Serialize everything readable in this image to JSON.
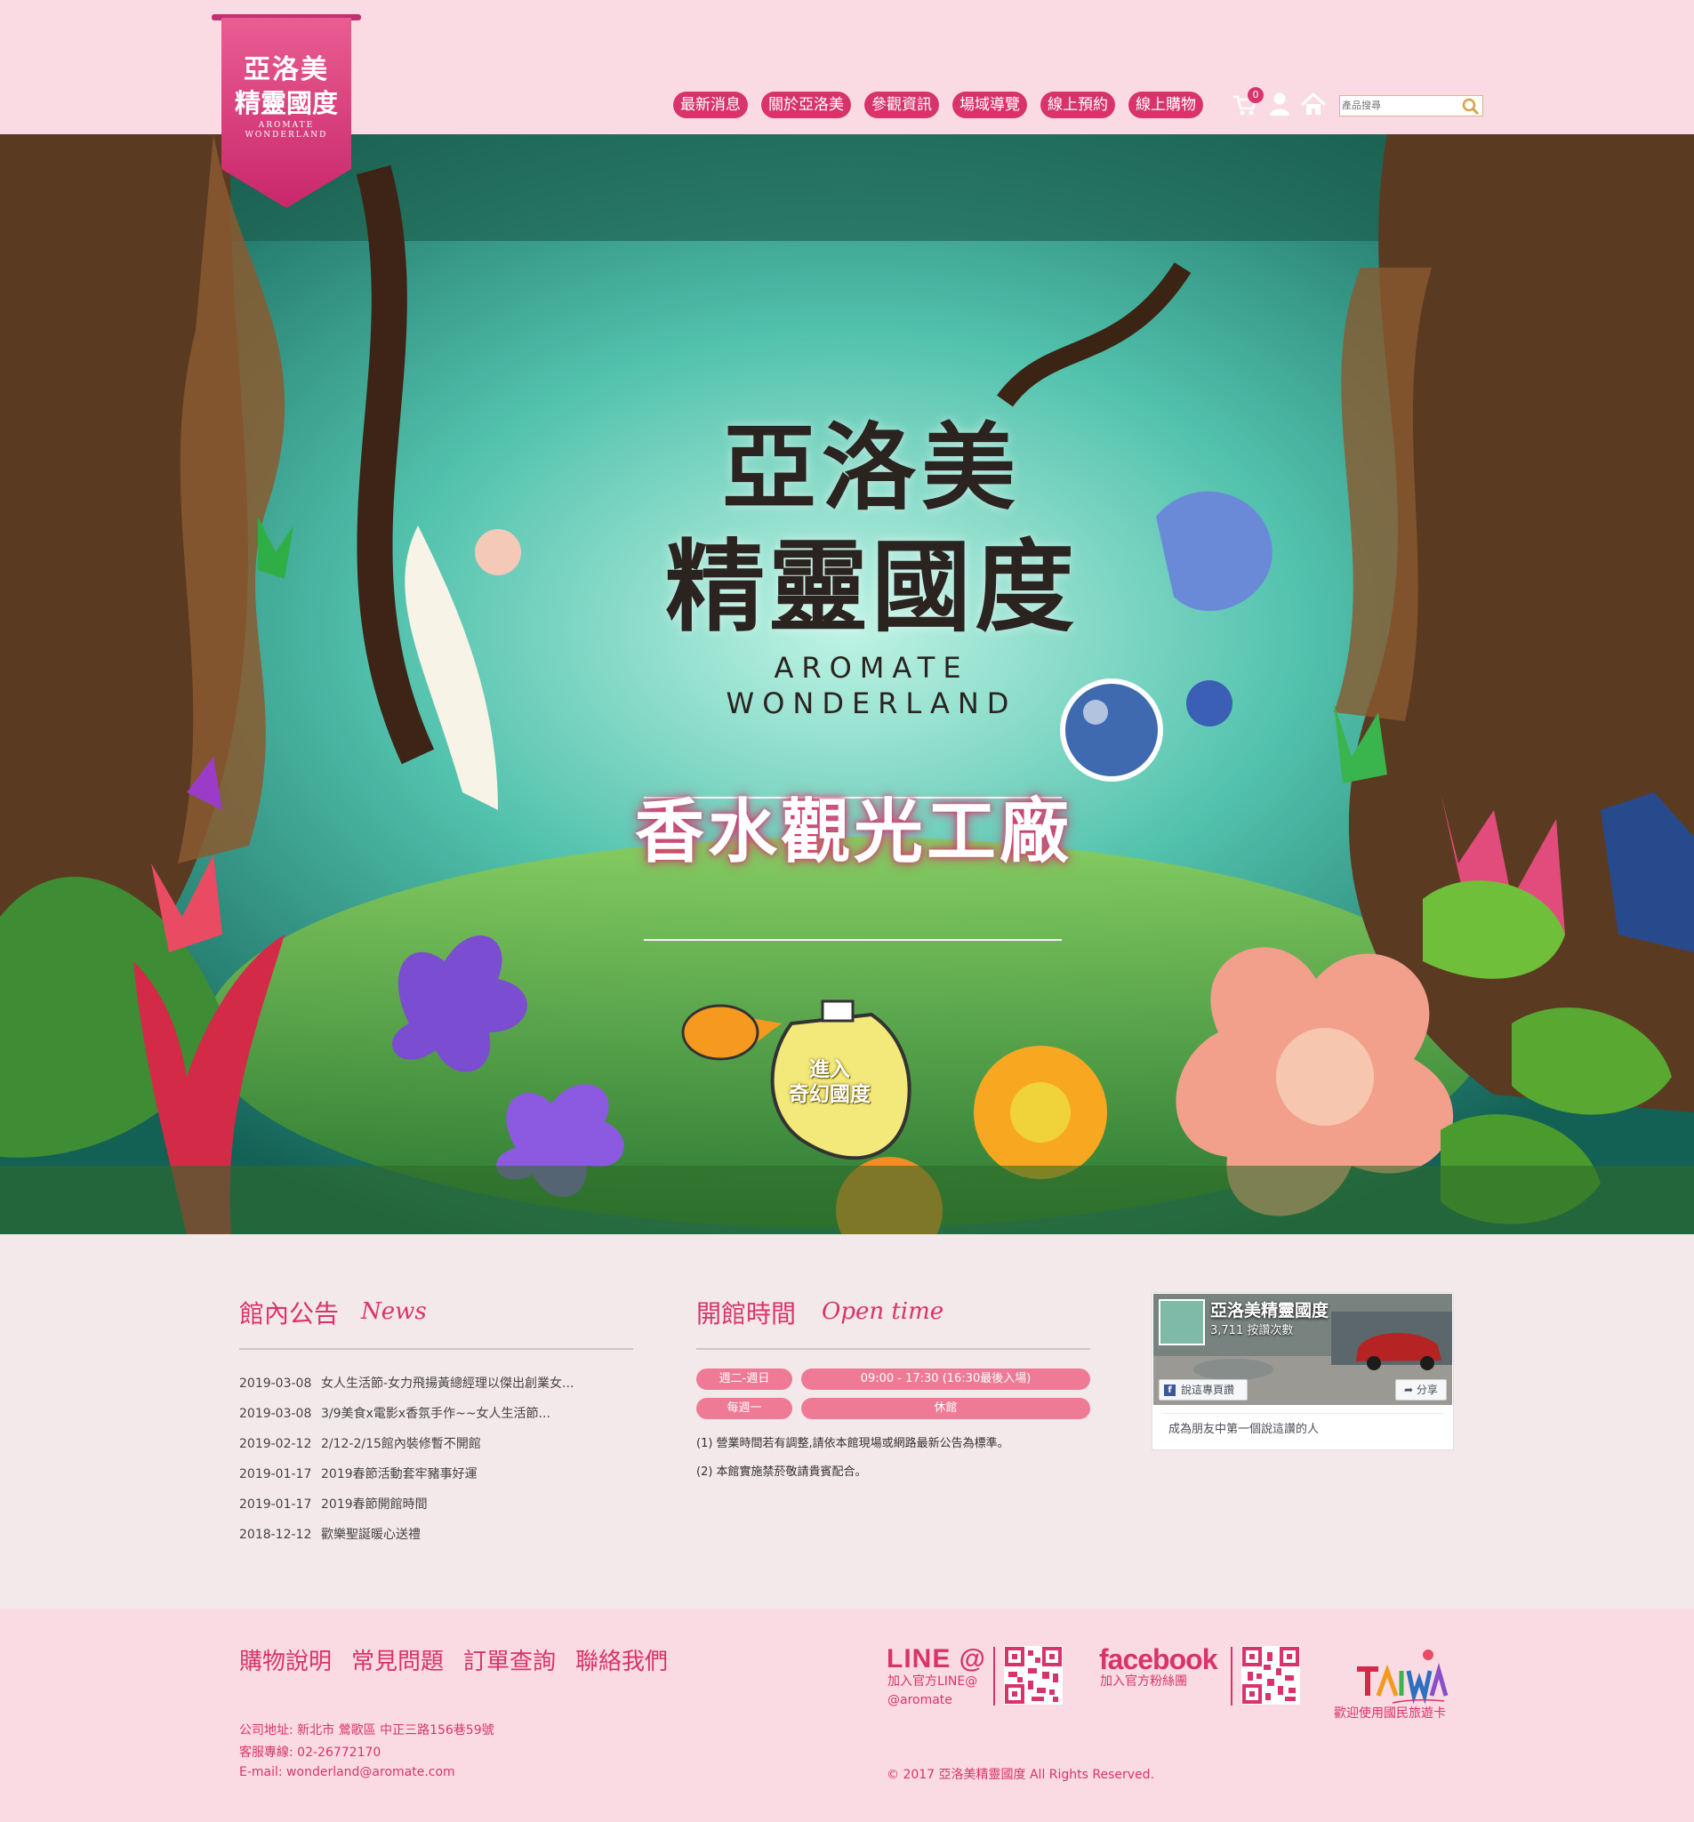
{
  "brand": {
    "logo_line1": "亞洛美",
    "logo_line2": "精靈國度",
    "logo_en": "AROMATE WONDERLAND"
  },
  "nav": {
    "items": [
      "最新消息",
      "關於亞洛美",
      "參觀資訊",
      "場域導覽",
      "線上預約",
      "線上購物"
    ],
    "cart_count": "0",
    "search_placeholder": "產品搜尋"
  },
  "hero": {
    "title_line1": "亞洛美",
    "title_line2": "精靈國度",
    "title_en1": "AROMATE",
    "title_en2": "WONDERLAND",
    "subtitle": "香水觀光工廠",
    "enter_line1": "進入",
    "enter_line2": "奇幻國度"
  },
  "news": {
    "title": "館內公告",
    "title_en": "News",
    "items": [
      {
        "date": "2019-03-08",
        "text": "女人生活節-女力飛揚黃總經理以傑出創業女..."
      },
      {
        "date": "2019-03-08",
        "text": "3/9美食x電影x香氛手作~~女人生活節..."
      },
      {
        "date": "2019-02-12",
        "text": "2/12-2/15館內裝修暫不開館"
      },
      {
        "date": "2019-01-17",
        "text": "2019春節活動套牢豬事好運"
      },
      {
        "date": "2019-01-17",
        "text": "2019春節開館時間"
      },
      {
        "date": "2018-12-12",
        "text": "歡樂聖誕暖心送禮"
      }
    ]
  },
  "open_time": {
    "title": "開館時間",
    "title_en": "Open time",
    "rows": [
      {
        "day": "週二-週日",
        "hours": "09:00 - 17:30 (16:30最後入場)"
      },
      {
        "day": "每週一",
        "hours": "休館"
      }
    ],
    "notes": [
      "(1) 營業時間若有調整,請依本館現場或網路最新公告為標準。",
      "(2) 本館實施禁菸敬請貴賓配合。"
    ]
  },
  "facebook_widget": {
    "page_name": "亞洛美精靈國度",
    "likes": "3,711 按讚次數",
    "like_button": "說這專頁讚",
    "share_button": "分享",
    "friend_text": "成為朋友中第一個說這讚的人"
  },
  "footer": {
    "links": [
      "購物說明",
      "常見問題",
      "訂單查詢",
      "聯絡我們"
    ],
    "address": "公司地址: 新北市 鶯歌區 中正三路156巷59號",
    "phone": "客服專線: 02-26772170",
    "email": "E-mail: wonderland@aromate.com",
    "line_logo": "LINE @",
    "line_sub": "加入官方LINE@",
    "line_id": "@aromate",
    "fb_logo": "facebook",
    "fb_sub": "加入官方粉絲團",
    "travel_card": "歡迎使用國民旅遊卡",
    "copyright": "© 2017 亞洛美精靈國度 All Rights Reserved."
  },
  "colors": {
    "accent": "#d9336b",
    "pink_bg": "#fbdbe3",
    "content_bg": "#f3e8ea",
    "pill": "#ee7a95"
  }
}
